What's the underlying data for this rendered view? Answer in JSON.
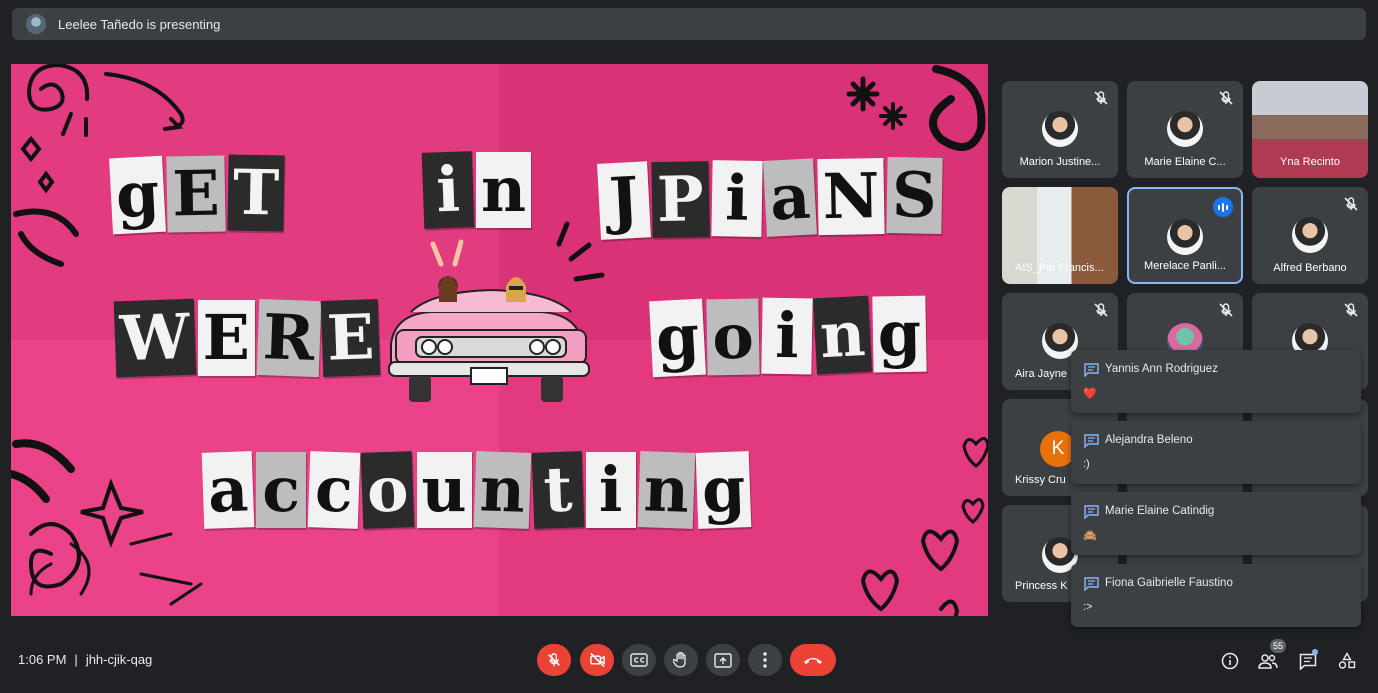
{
  "presenting": {
    "text": "Leelee Tañedo is presenting"
  },
  "slide": {
    "words": [
      {
        "text": "gET",
        "colors": [
          "w",
          "g",
          "d"
        ]
      },
      {
        "text": "in",
        "colors": [
          "d",
          "w"
        ]
      },
      {
        "text": "JPiaNS",
        "colors": [
          "w",
          "d",
          "w",
          "g",
          "w",
          "g"
        ]
      },
      {
        "text": "WERE",
        "colors": [
          "d",
          "w",
          "g",
          "d"
        ]
      },
      {
        "text": "going",
        "colors": [
          "w",
          "g",
          "w",
          "d",
          "w"
        ]
      },
      {
        "text": "accounting",
        "colors": [
          "w",
          "g",
          "w",
          "d",
          "w",
          "g",
          "d",
          "w",
          "g",
          "w"
        ]
      }
    ]
  },
  "participants": [
    {
      "name": "Marion Justine...",
      "muted": true
    },
    {
      "name": "Marie Elaine C...",
      "muted": true
    },
    {
      "name": "Yna Recinto",
      "muted": false
    },
    {
      "name": "AIS_Pat Francis...",
      "muted": false
    },
    {
      "name": "Merelace Panli...",
      "muted": false,
      "speaking": true
    },
    {
      "name": "Alfred Berbano",
      "muted": true
    },
    {
      "name": "Aira Jayne",
      "muted": true
    },
    {
      "name": "",
      "muted": true
    },
    {
      "name": "",
      "muted": true
    },
    {
      "name": "Krissy Cru",
      "muted": true,
      "initial": "K"
    },
    {
      "name": "Princess K",
      "muted": true
    }
  ],
  "chat": [
    {
      "name": "Yannis Ann Rodriguez",
      "message": "❤️"
    },
    {
      "name": "Alejandra Beleno",
      "message": ":)"
    },
    {
      "name": "Marie Elaine Catindig",
      "message": "🙈"
    },
    {
      "name": "Fiona Gaibrielle Faustino",
      "message": ":>"
    }
  ],
  "bottom": {
    "time": "1:06 PM",
    "separator": "|",
    "code": "jhh-cjik-qag",
    "participant_count": "55"
  },
  "colors": {
    "background": "#202124",
    "tile": "#3c4043",
    "slide_pink": "#e8357f",
    "red": "#ea4335",
    "blue": "#8ab4f8"
  }
}
